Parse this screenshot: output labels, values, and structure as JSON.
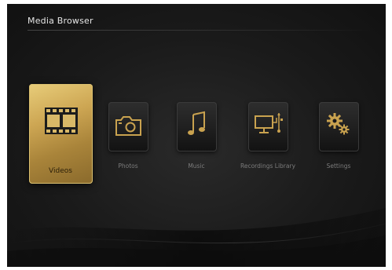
{
  "header": {
    "title": "Media Browser"
  },
  "menu": {
    "items": [
      {
        "label": "Videos",
        "icon": "film-strip-icon",
        "selected": true
      },
      {
        "label": "Photos",
        "icon": "camera-icon",
        "selected": false
      },
      {
        "label": "Music",
        "icon": "music-note-icon",
        "selected": false
      },
      {
        "label": "Recordings Library",
        "icon": "monitor-usb-icon",
        "selected": false
      },
      {
        "label": "Settings",
        "icon": "gears-icon",
        "selected": false
      }
    ]
  },
  "colors": {
    "accent_gold": "#c9a24f",
    "background": "#1a1a1a"
  }
}
